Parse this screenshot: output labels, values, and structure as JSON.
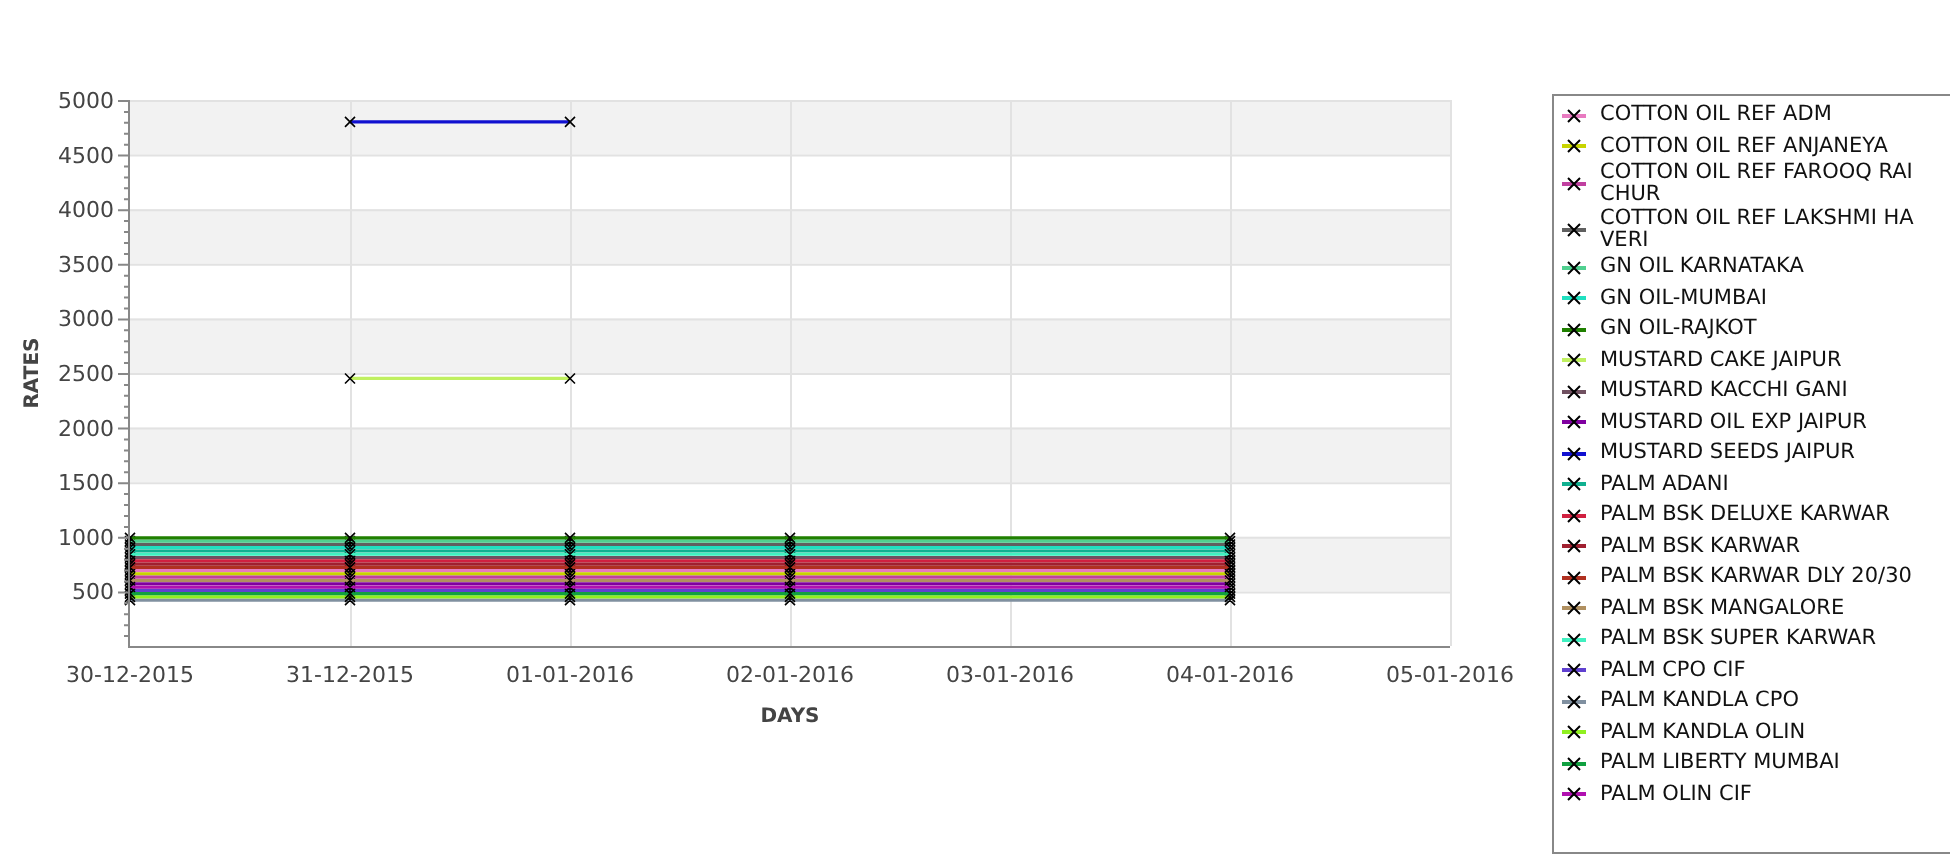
{
  "chart": {
    "chart_data": {
      "type": "line",
      "xlabel": "DAYS",
      "ylabel": "RATES",
      "grid": true,
      "categories": [
        "30-12-2015",
        "31-12-2015",
        "01-01-2016",
        "02-01-2016",
        "03-01-2016",
        "04-01-2016",
        "05-01-2016"
      ],
      "ylim": [
        0,
        5000
      ],
      "yticks": [
        500,
        1000,
        1500,
        2000,
        2500,
        3000,
        3500,
        4000,
        4500,
        5000
      ],
      "series": [
        {
          "name": "COTTON OIL REF ADM",
          "color": "#e87ac0",
          "marker": "x",
          "values": [
            690,
            690,
            690,
            690,
            null,
            690,
            null
          ]
        },
        {
          "name": "COTTON OIL REF ANJANEYA",
          "color": "#c8d400",
          "marker": "x",
          "values": [
            660,
            660,
            660,
            660,
            null,
            660,
            null
          ]
        },
        {
          "name": "COTTON OIL REF FAROOQ RAICHUR",
          "color": "#c040a0",
          "marker": "x",
          "values": [
            630,
            630,
            630,
            630,
            null,
            630,
            null
          ]
        },
        {
          "name": "COTTON OIL REF LAKSHMI HAVERI",
          "color": "#606060",
          "marker": "x",
          "values": [
            930,
            930,
            930,
            930,
            null,
            930,
            null
          ]
        },
        {
          "name": "GN OIL KARNATAKA",
          "color": "#50d090",
          "marker": "x",
          "values": [
            960,
            960,
            960,
            960,
            null,
            960,
            null
          ]
        },
        {
          "name": "GN OIL-MUMBAI",
          "color": "#20e0c0",
          "marker": "x",
          "values": [
            900,
            900,
            900,
            900,
            null,
            900,
            null
          ]
        },
        {
          "name": "GN OIL-RAJKOT",
          "color": "#208000",
          "marker": "x",
          "values": [
            990,
            990,
            990,
            990,
            null,
            990,
            null
          ]
        },
        {
          "name": "MUSTARD CAKE JAIPUR",
          "color": "#c0f060",
          "marker": "x",
          "values": [
            null,
            2450,
            2450,
            null,
            null,
            null,
            null
          ]
        },
        {
          "name": "MUSTARD KACCHI GANI",
          "color": "#705060",
          "marker": "x",
          "values": [
            810,
            810,
            810,
            810,
            null,
            810,
            null
          ]
        },
        {
          "name": "MUSTARD OIL EXP JAIPUR",
          "color": "#8000a0",
          "marker": "x",
          "values": [
            570,
            570,
            570,
            570,
            null,
            570,
            null
          ]
        },
        {
          "name": "MUSTARD SEEDS JAIPUR",
          "color": "#1010d0",
          "marker": "x",
          "values": [
            null,
            4800,
            4800,
            null,
            null,
            null,
            null
          ]
        },
        {
          "name": "PALM ADANI",
          "color": "#10b090",
          "marker": "x",
          "values": [
            870,
            870,
            870,
            870,
            null,
            870,
            null
          ]
        },
        {
          "name": "PALM BSK DELUXE KARWAR",
          "color": "#d02040",
          "marker": "x",
          "values": [
            780,
            780,
            780,
            780,
            null,
            780,
            null
          ]
        },
        {
          "name": "PALM BSK KARWAR",
          "color": "#a02030",
          "marker": "x",
          "values": [
            750,
            750,
            750,
            750,
            null,
            750,
            null
          ]
        },
        {
          "name": "PALM BSK KARWAR DLY 20/30",
          "color": "#b03020",
          "marker": "x",
          "values": [
            720,
            720,
            720,
            720,
            null,
            720,
            null
          ]
        },
        {
          "name": "PALM BSK MANGALORE",
          "color": "#b09060",
          "marker": "x",
          "values": [
            600,
            600,
            600,
            600,
            null,
            600,
            null
          ]
        },
        {
          "name": "PALM BSK SUPER KARWAR",
          "color": "#40f0c0",
          "marker": "x",
          "values": [
            840,
            840,
            840,
            840,
            null,
            840,
            null
          ]
        },
        {
          "name": "PALM CPO CIF",
          "color": "#6040d0",
          "marker": "x",
          "values": [
            510,
            510,
            510,
            510,
            null,
            510,
            null
          ]
        },
        {
          "name": "PALM KANDLA CPO",
          "color": "#8090a0",
          "marker": "x",
          "values": [
            420,
            420,
            420,
            420,
            null,
            420,
            null
          ]
        },
        {
          "name": "PALM KANDLA OLIN",
          "color": "#90f020",
          "marker": "x",
          "values": [
            450,
            450,
            450,
            450,
            null,
            450,
            null
          ]
        },
        {
          "name": "PALM LIBERTY MUMBAI",
          "color": "#10a040",
          "marker": "x",
          "values": [
            480,
            480,
            480,
            480,
            null,
            480,
            null
          ]
        },
        {
          "name": "PALM OLIN CIF",
          "color": "#b010b0",
          "marker": "x",
          "values": [
            540,
            540,
            540,
            540,
            null,
            540,
            null
          ]
        }
      ]
    }
  }
}
